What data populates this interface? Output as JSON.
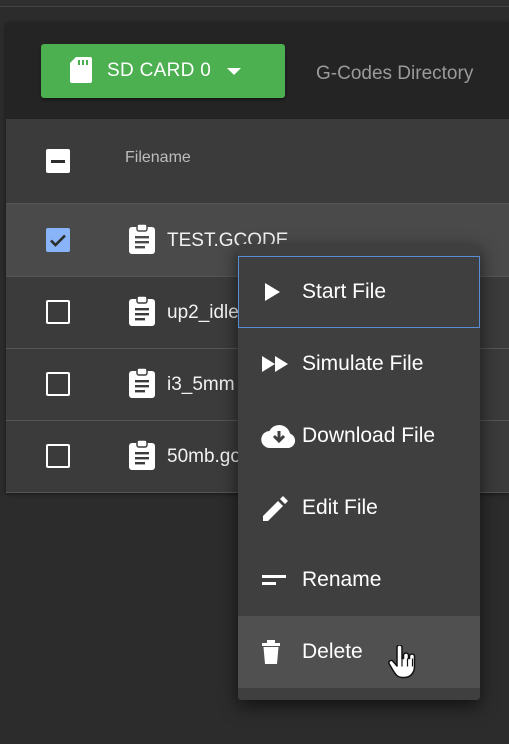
{
  "toolbar": {
    "sd_button_label": "SD CARD 0",
    "directory_label": "G-Codes Directory"
  },
  "table": {
    "header": {
      "filename_label": "Filename"
    },
    "rows": [
      {
        "name": "TEST.GCODE",
        "checked": true
      },
      {
        "name": "up2_idle"
      },
      {
        "name": "i3_5mm"
      },
      {
        "name": "50mb.go"
      }
    ]
  },
  "context_menu": {
    "items": [
      {
        "label": "Start File",
        "icon": "play-icon"
      },
      {
        "label": "Simulate File",
        "icon": "fast-forward-icon"
      },
      {
        "label": "Download File",
        "icon": "cloud-download-icon"
      },
      {
        "label": "Edit File",
        "icon": "pencil-icon"
      },
      {
        "label": "Rename",
        "icon": "rename-icon"
      },
      {
        "label": "Delete",
        "icon": "trash-icon"
      }
    ]
  },
  "colors": {
    "accent_green": "#4caf50",
    "checkbox_checked": "#8ab4f8",
    "focus_outline": "#5a8dd8"
  }
}
